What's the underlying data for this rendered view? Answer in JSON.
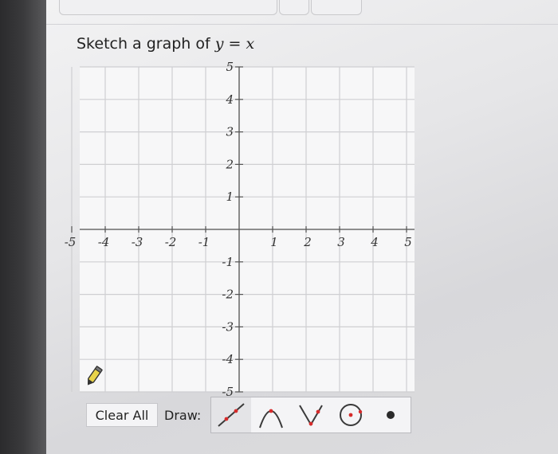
{
  "prompt": {
    "text": "Sketch a graph of",
    "equation": "y = x"
  },
  "graph": {
    "x_labels": [
      "-5",
      "-4",
      "-3",
      "-2",
      "-1",
      "1",
      "2",
      "3",
      "4",
      "5"
    ],
    "y_labels": [
      "5",
      "4",
      "3",
      "2",
      "1",
      "-1",
      "-2",
      "-3",
      "-4",
      "-5"
    ],
    "x_range": [
      -5,
      5
    ],
    "y_range": [
      -5,
      5
    ],
    "grid": true
  },
  "toolbar": {
    "clear_label": "Clear All",
    "draw_label": "Draw:",
    "tools": [
      {
        "name": "line-tool-icon",
        "active": true
      },
      {
        "name": "parabola-tool-icon",
        "active": false
      },
      {
        "name": "absolute-value-tool-icon",
        "active": false
      },
      {
        "name": "circle-tool-icon",
        "active": false
      },
      {
        "name": "point-tool-icon",
        "active": false
      }
    ]
  },
  "colors": {
    "grid": "#cfcfd2",
    "axis": "#555555",
    "accent": "#d62b2b",
    "tool_stroke": "#3a3a3a"
  }
}
